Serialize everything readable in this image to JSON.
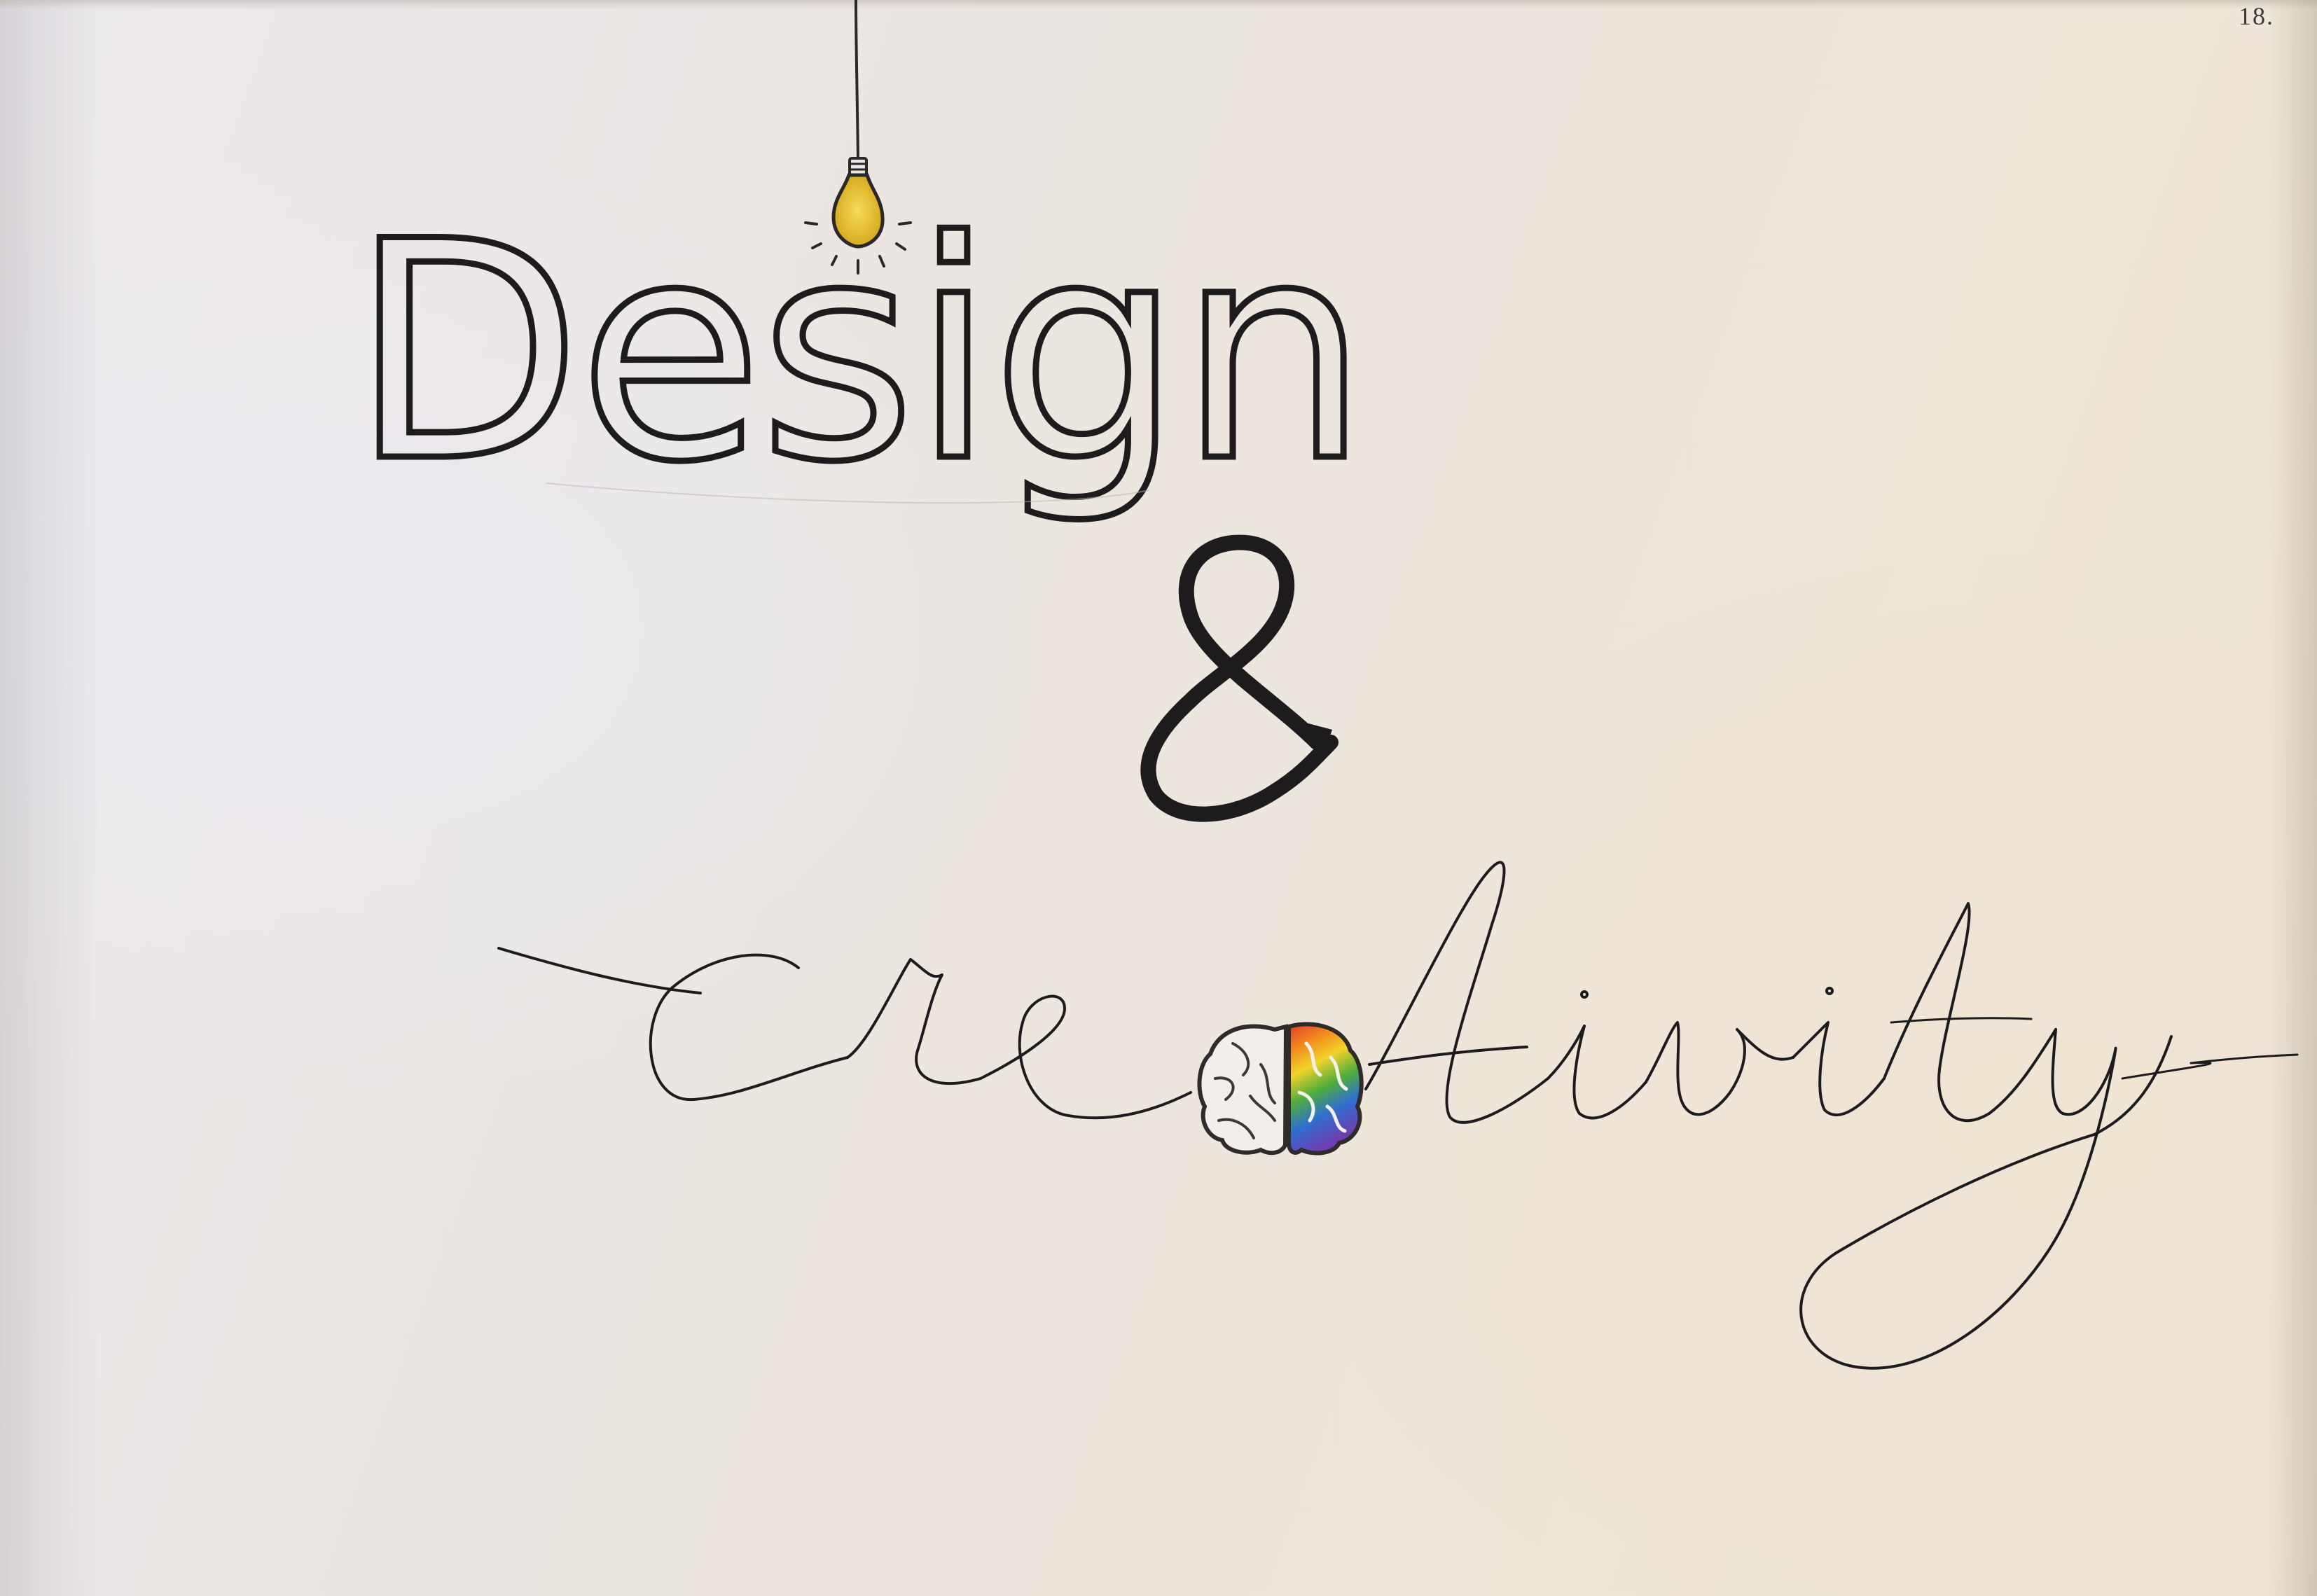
{
  "page": {
    "page_number": "18.",
    "paper_color": "#ece8e3"
  },
  "artwork": {
    "word_1": "Design",
    "ampersand": "&",
    "word_2": "creativity",
    "ink_color": "#1d1b1c",
    "pencil_color": "#555050",
    "bulb_color": "#e8c33a",
    "bulb_icon": "lightbulb-icon",
    "brain_icon": "brain-icon",
    "brain_rainbow": [
      "#e23a2c",
      "#f28a1e",
      "#f3d22b",
      "#4fae3a",
      "#2f6fd0",
      "#6b3fb3"
    ]
  }
}
